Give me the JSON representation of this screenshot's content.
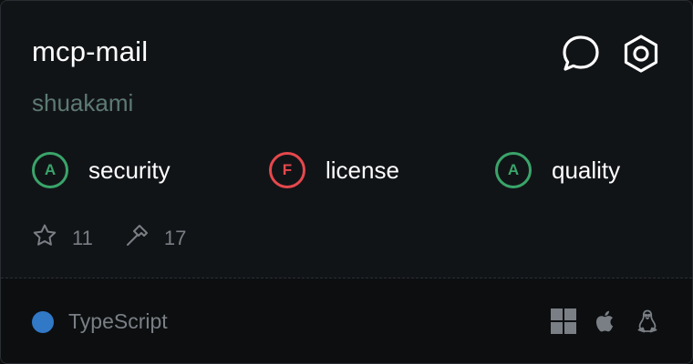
{
  "repo": {
    "name": "mcp-mail",
    "owner": "shuakami"
  },
  "header_icons": [
    {
      "name": "chat-icon"
    },
    {
      "name": "settings-hex-icon"
    }
  ],
  "grades": [
    {
      "letter": "A",
      "label": "security",
      "color": "#3aa46a",
      "text_color": "#3aa46a"
    },
    {
      "letter": "F",
      "label": "license",
      "color": "#e5484d",
      "text_color": "#e5484d"
    },
    {
      "letter": "A",
      "label": "quality",
      "color": "#3aa46a",
      "text_color": "#3aa46a"
    }
  ],
  "stats": {
    "stars": "11",
    "tools": "17"
  },
  "language": {
    "name": "TypeScript",
    "color": "#3178c6"
  },
  "platforms": [
    "windows-icon",
    "apple-icon",
    "linux-icon"
  ]
}
